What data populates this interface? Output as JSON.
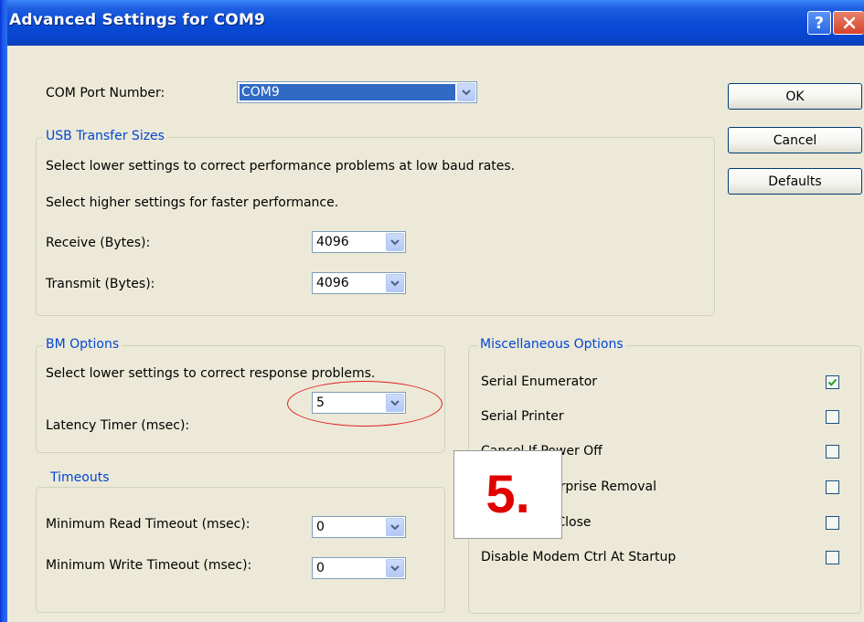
{
  "window": {
    "title": "Advanced Settings for COM9",
    "help_label": "?"
  },
  "com_port": {
    "label": "COM Port Number:",
    "value": "COM9"
  },
  "buttons": {
    "ok": "OK",
    "cancel": "Cancel",
    "defaults": "Defaults"
  },
  "usb": {
    "legend": "USB Transfer Sizes",
    "line1": "Select lower settings to correct performance problems at low baud rates.",
    "line2": "Select higher settings for faster performance.",
    "receive_label": "Receive (Bytes):",
    "receive_value": "4096",
    "transmit_label": "Transmit (Bytes):",
    "transmit_value": "4096"
  },
  "bm": {
    "legend": "BM Options",
    "line1": "Select lower settings to correct response problems.",
    "latency_label": "Latency Timer (msec):",
    "latency_value": "5"
  },
  "timeouts": {
    "legend": "Timeouts",
    "read_label": "Minimum Read Timeout (msec):",
    "read_value": "0",
    "write_label": "Minimum Write Timeout (msec):",
    "write_value": "0"
  },
  "misc": {
    "legend": "Miscellaneous Options",
    "items": [
      {
        "label": "Serial Enumerator",
        "checked": true
      },
      {
        "label": "Serial Printer",
        "checked": false
      },
      {
        "label": "Cancel If Power Off",
        "checked": false
      },
      {
        "label": "Event On Surprise Removal",
        "checked": false
      },
      {
        "label": "Set RTS On Close",
        "checked": false
      },
      {
        "label": "Disable Modem Ctrl At Startup",
        "checked": false
      }
    ]
  },
  "annotation": {
    "step_label": "5.",
    "color": "#e00000"
  },
  "colors": {
    "titlebar": "#0a4bd6",
    "legend_text": "#0046d5",
    "selection": "#316ac5"
  }
}
